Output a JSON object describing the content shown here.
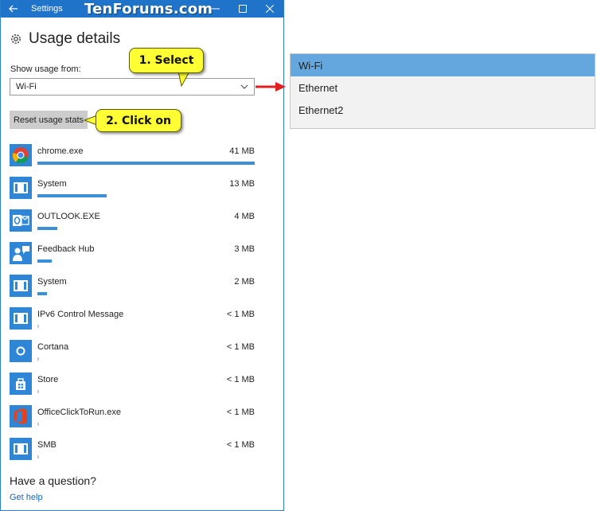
{
  "window": {
    "title": "Settings",
    "watermark": "TenForums.com"
  },
  "page": {
    "title": "Usage details",
    "show_usage_label": "Show usage from:",
    "dropdown_value": "Wi-Fi",
    "reset_button": "Reset usage stats"
  },
  "callouts": {
    "step1": "1. Select",
    "step2": "2. Click on"
  },
  "apps": [
    {
      "name": "chrome.exe",
      "size": "41 MB",
      "usage_fraction": 1.0,
      "icon": "chrome-icon"
    },
    {
      "name": "System",
      "size": "13 MB",
      "usage_fraction": 0.32,
      "icon": "system-icon"
    },
    {
      "name": "OUTLOOK.EXE",
      "size": "4 MB",
      "usage_fraction": 0.09,
      "icon": "outlook-icon"
    },
    {
      "name": "Feedback Hub",
      "size": "3 MB",
      "usage_fraction": 0.065,
      "icon": "feedback-hub-icon"
    },
    {
      "name": "System",
      "size": "2 MB",
      "usage_fraction": 0.045,
      "icon": "system-icon"
    },
    {
      "name": "IPv6 Control Message",
      "size": "< 1 MB",
      "usage_fraction": 0.006,
      "icon": "system-icon"
    },
    {
      "name": "Cortana",
      "size": "< 1 MB",
      "usage_fraction": 0.006,
      "icon": "cortana-icon"
    },
    {
      "name": "Store",
      "size": "< 1 MB",
      "usage_fraction": 0.006,
      "icon": "store-icon"
    },
    {
      "name": "OfficeClickToRun.exe",
      "size": "< 1 MB",
      "usage_fraction": 0.006,
      "icon": "office-icon"
    },
    {
      "name": "SMB",
      "size": "< 1 MB",
      "usage_fraction": 0.006,
      "icon": "system-icon"
    }
  ],
  "footer": {
    "question": "Have a question?",
    "get_help": "Get help"
  },
  "dropdown_options": [
    {
      "label": "Wi-Fi",
      "selected": true
    },
    {
      "label": "Ethernet",
      "selected": false
    },
    {
      "label": "Ethernet2",
      "selected": false
    }
  ],
  "colors": {
    "titlebar": "#1f73c9",
    "usage_bar": "#3a8fd6",
    "selected_option": "#64a7df",
    "callout": "#ffff33",
    "arrow": "#e02020"
  }
}
